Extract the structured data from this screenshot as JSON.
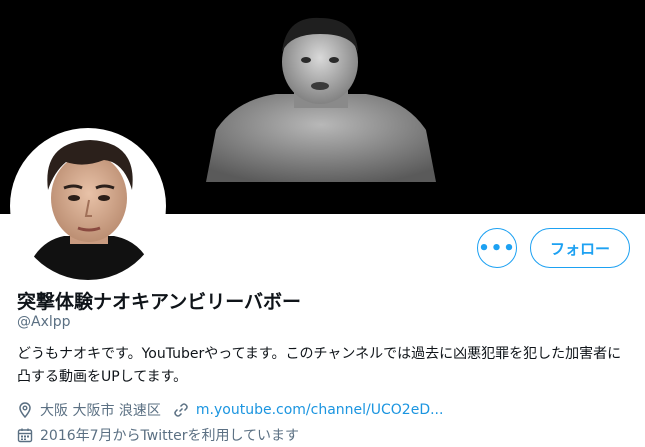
{
  "profile": {
    "display_name": "突撃体験ナオキアンビリーバボー",
    "handle": "@Axlpp",
    "bio": "どうもナオキです。YouTuberやってます。このチャンネルでは過去に凶悪犯罪を犯した加害者に凸する動画をUPしてます。",
    "location": "大阪 大阪市 浪速区",
    "url": "m.youtube.com/channel/UCO2eD...",
    "joined": "2016年7月からTwitterを利用しています"
  },
  "actions": {
    "more_label": "•••",
    "follow_label": "フォロー"
  },
  "icons": {
    "location": "location-pin-icon",
    "link": "link-icon",
    "calendar": "calendar-icon",
    "more": "more-icon"
  },
  "colors": {
    "accent": "#1da1f2",
    "link": "#1b95e0",
    "secondary_text": "#5b7083",
    "banner_bg": "#000000"
  }
}
